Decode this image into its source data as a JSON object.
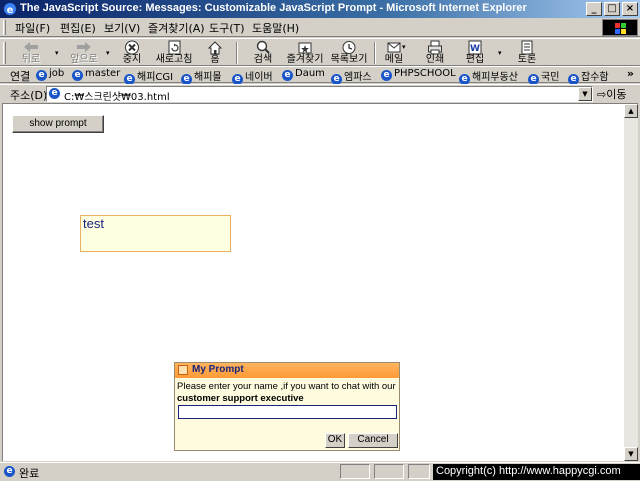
{
  "window": {
    "title": "The JavaScript Source: Messages: Customizable JavaScript Prompt - Microsoft Internet Explorer",
    "minimize": "_",
    "maximize": "□",
    "close": "×"
  },
  "menu": {
    "items": [
      "파일(F)",
      "편집(E)",
      "보기(V)",
      "즐겨찾기(A)",
      "도구(T)",
      "도움말(H)"
    ]
  },
  "toolbar": {
    "buttons": [
      {
        "label": "뒤로",
        "icon": "back-arrow-icon",
        "enabled": false
      },
      {
        "label": "앞으로",
        "icon": "forward-arrow-icon",
        "enabled": false
      },
      {
        "label": "중지",
        "icon": "stop-icon",
        "enabled": true
      },
      {
        "label": "새로고침",
        "icon": "refresh-icon",
        "enabled": true
      },
      {
        "label": "홈",
        "icon": "home-icon",
        "enabled": true
      },
      {
        "label": "검색",
        "icon": "search-icon",
        "enabled": true
      },
      {
        "label": "즐겨찾기",
        "icon": "favorites-icon",
        "enabled": true
      },
      {
        "label": "목록보기",
        "icon": "history-icon",
        "enabled": true
      },
      {
        "label": "메일",
        "icon": "mail-icon",
        "enabled": true
      },
      {
        "label": "인쇄",
        "icon": "print-icon",
        "enabled": true
      },
      {
        "label": "편집",
        "icon": "edit-icon",
        "enabled": true
      },
      {
        "label": "토론",
        "icon": "discuss-icon",
        "enabled": true
      }
    ]
  },
  "links": {
    "caption": "연결",
    "items": [
      "job",
      "master",
      "해피CGI",
      "해피몰",
      "네이버",
      "Daum",
      "엠파스",
      "PHPSCHOOL",
      "해피부동산",
      "국민",
      "잡수함"
    ],
    "more": "»"
  },
  "address": {
    "caption": "주소(D)",
    "value": "C:₩스크린샷₩03.html",
    "go_label": "이동"
  },
  "page": {
    "show_prompt_label": "show prompt",
    "test_text": "test",
    "prompt": {
      "title": "My Prompt",
      "message": "Please enter your name ,if you want to chat with our",
      "message_bold": "customer support executive",
      "input_value": "",
      "ok_label": "OK",
      "cancel_label": "Cancel"
    }
  },
  "status": {
    "text": "완료",
    "copyright": "Copyright(c) http://www.happycgi.com"
  }
}
